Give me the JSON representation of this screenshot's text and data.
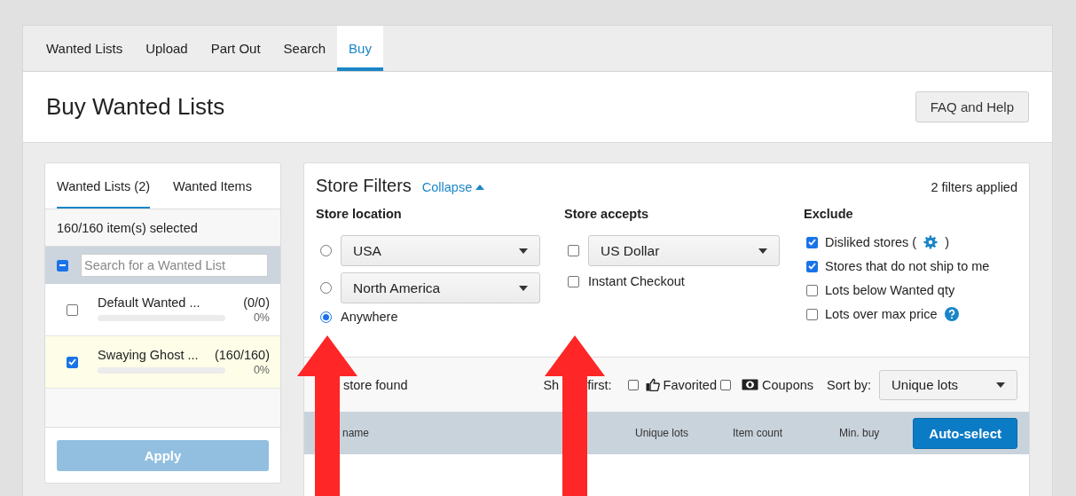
{
  "nav_tabs": [
    {
      "label": "Wanted Lists",
      "selected": false
    },
    {
      "label": "Upload",
      "selected": false
    },
    {
      "label": "Part Out",
      "selected": false
    },
    {
      "label": "Search",
      "selected": false
    },
    {
      "label": "Buy",
      "selected": true
    }
  ],
  "page_title": "Buy Wanted Lists",
  "help_button": "FAQ and Help",
  "sidebar": {
    "tabs": [
      {
        "label": "Wanted Lists (2)",
        "selected": true
      },
      {
        "label": "Wanted Items",
        "selected": false
      }
    ],
    "selection_summary": "160/160 item(s) selected",
    "select_all": {
      "indeterminate": true
    },
    "search": {
      "placeholder": "Search for a Wanted List"
    },
    "lists": [
      {
        "name": "Default Wanted ...",
        "count": "(0/0)",
        "level": 0,
        "percent": "0%",
        "checked": false
      },
      {
        "name": "Swaying Ghost ...",
        "count": "(160/160)",
        "level": 0,
        "percent": "0%",
        "checked": true
      }
    ],
    "apply_button": {
      "label": "Apply",
      "disabled": true
    }
  },
  "filters": {
    "title": "Store Filters",
    "collapse_link": "Collapse",
    "applied": "2 filters applied",
    "location": {
      "heading": "Store location",
      "options": [
        {
          "kind": "select",
          "label": "USA",
          "selected": false
        },
        {
          "kind": "select",
          "label": "North America",
          "selected": false
        },
        {
          "kind": "text",
          "label": "Anywhere",
          "selected": true
        }
      ]
    },
    "accepts": {
      "heading": "Store accepts",
      "options": [
        {
          "kind": "select",
          "label": "US Dollar",
          "checked": false
        },
        {
          "kind": "text",
          "label": "Instant Checkout",
          "checked": false
        }
      ]
    },
    "exclude": {
      "heading": "Exclude",
      "options": [
        {
          "kind": "settings",
          "label": "Disliked stores (",
          "suffix": ")",
          "checked": true
        },
        {
          "kind": "plain",
          "label": "Stores that do not ship to me",
          "checked": true
        },
        {
          "kind": "plain",
          "label": "Lots below Wanted qty",
          "checked": false
        },
        {
          "kind": "help",
          "label": "Lots over max price",
          "checked": false
        }
      ]
    }
  },
  "results": {
    "count_text": "store found",
    "show_first_parts": [
      "Sh",
      "first:"
    ],
    "show_first": [
      {
        "kind": "thumb",
        "label": "Favorited",
        "checked": false
      },
      {
        "kind": "coupon",
        "label": "Coupons",
        "checked": false
      }
    ],
    "sort_label": "Sort by:",
    "sort_value": "Unique lots",
    "columns": [
      "name",
      "Unique lots",
      "Item count",
      "Min. buy"
    ],
    "auto_select_button": "Auto-select"
  },
  "annotations": [
    {
      "kind": "arrow"
    },
    {
      "kind": "arrow"
    }
  ]
}
